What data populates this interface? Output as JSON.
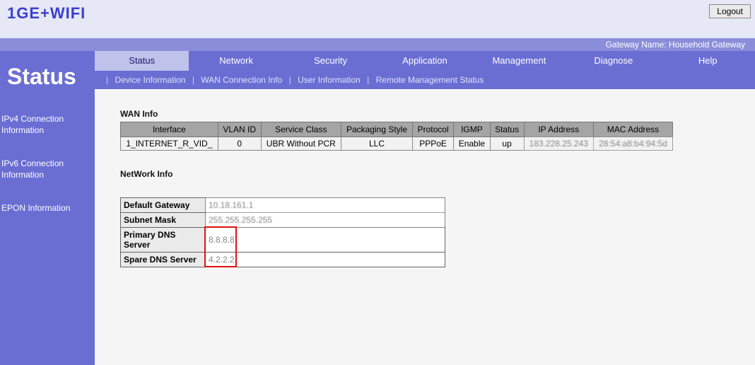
{
  "brand": "1GE+WIFI",
  "logout_label": "Logout",
  "gateway_name": "Gateway Name: Household Gateway",
  "page_title": "Status",
  "side_links": [
    "IPv4 Connection Information",
    "IPv6 Connection Information",
    "EPON Information"
  ],
  "tabs": [
    "Status",
    "Network",
    "Security",
    "Application",
    "Management",
    "Diagnose",
    "Help"
  ],
  "subnav": [
    "Device Information",
    "WAN Connection Info",
    "User Information",
    "Remote Management Status"
  ],
  "wan_info": {
    "title": "WAN Info",
    "headers": [
      "Interface",
      "VLAN ID",
      "Service Class",
      "Packaging Style",
      "Protocol",
      "IGMP",
      "Status",
      "IP Address",
      "MAC Address"
    ],
    "row": {
      "interface": "1_INTERNET_R_VID_",
      "vlan": "0",
      "service": "UBR Without PCR",
      "packaging": "LLC",
      "protocol": "PPPoE",
      "igmp": "Enable",
      "status": "up",
      "ip": "183.228.25.243",
      "mac": "28:54:a8:b4:94:5d"
    }
  },
  "network_info": {
    "title": "NetWork Info",
    "default_gateway_label": "Default Gateway",
    "default_gateway": "10.18.161.1",
    "subnet_label": "Subnet Mask",
    "subnet": "255.255.255.255",
    "primary_dns_label": "Primary DNS Server",
    "primary_dns": "8.8.8.8",
    "spare_dns_label": "Spare DNS Server",
    "spare_dns": "4.2.2.2"
  }
}
